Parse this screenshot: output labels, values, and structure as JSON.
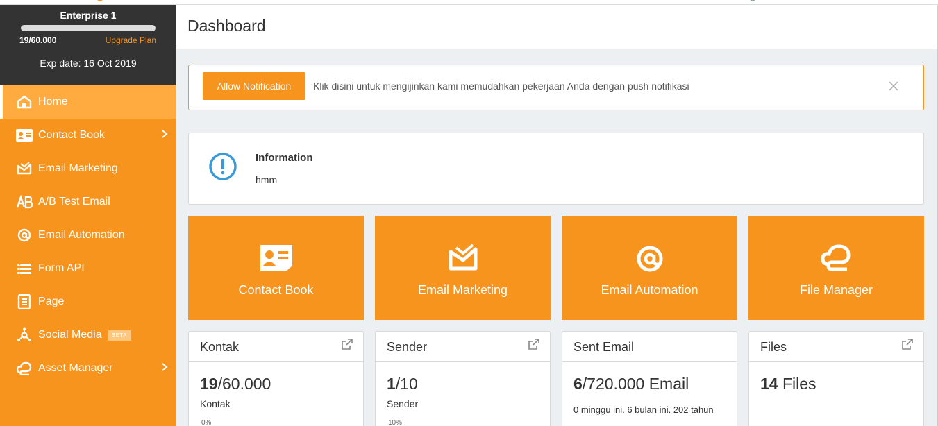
{
  "colors": {
    "accent": "#f7941d",
    "accent_light": "#ffab40",
    "dark": "#333333",
    "info_blue": "#3a9ad9"
  },
  "plan": {
    "name": "Enterprise 1",
    "quota": "19/60.000",
    "usage_fraction": 0.0003,
    "upgrade_label": "Upgrade Plan",
    "exp": "Exp date: 16 Oct 2019"
  },
  "sidebar": {
    "items": [
      {
        "label": "Home",
        "icon": "home-icon",
        "active": true,
        "chevron": false
      },
      {
        "label": "Contact Book",
        "icon": "contact-card-icon",
        "chevron": true
      },
      {
        "label": "Email Marketing",
        "icon": "envelope-icon",
        "chevron": false
      },
      {
        "label": "A/B Test Email",
        "icon": "ab-test-icon",
        "chevron": false
      },
      {
        "label": "Email Automation",
        "icon": "at-sign-icon",
        "chevron": false
      },
      {
        "label": "Form API",
        "icon": "form-list-icon",
        "chevron": false
      },
      {
        "label": "Page",
        "icon": "page-icon",
        "chevron": false
      },
      {
        "label": "Social Media",
        "icon": "social-network-icon",
        "badge": "BETA",
        "chevron": false
      },
      {
        "label": "Asset Manager",
        "icon": "cloud-icon",
        "chevron": true
      }
    ]
  },
  "header": {
    "title": "Dashboard"
  },
  "notification": {
    "button_label": "Allow Notification",
    "text": "Klik disini untuk mengijinkan kami memudahkan pekerjaan Anda dengan push notifikasi"
  },
  "information": {
    "title": "Information",
    "body": "hmm"
  },
  "tiles": [
    {
      "label": "Contact Book",
      "icon": "contact-card-icon"
    },
    {
      "label": "Email Marketing",
      "icon": "envelope-icon"
    },
    {
      "label": "Email Automation",
      "icon": "at-sign-icon"
    },
    {
      "label": "File Manager",
      "icon": "cloud-icon"
    }
  ],
  "stats": [
    {
      "title": "Kontak",
      "value_bold": "19",
      "value_rest": "/60.000",
      "sub": "Kontak",
      "frag": "0%"
    },
    {
      "title": "Sender",
      "value_bold": "1",
      "value_rest": "/10",
      "sub": "Sender",
      "frag": "10%"
    },
    {
      "title": "Sent Email",
      "value_bold": "6",
      "value_rest": "/720.000 Email",
      "note": "0 minggu ini. 6 bulan ini. 202 tahun"
    },
    {
      "title": "Files",
      "value_bold": "14",
      "value_rest": " Files"
    }
  ]
}
